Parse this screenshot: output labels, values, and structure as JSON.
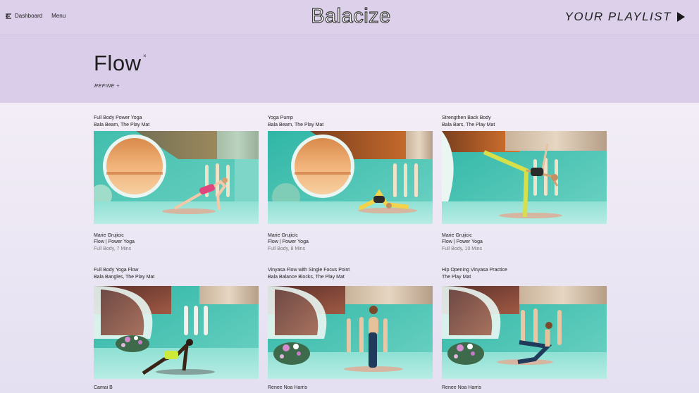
{
  "header": {
    "dashboard_label": "Dashboard",
    "menu_label": "Menu",
    "logo_text": "Balacize",
    "playlist_label": "YOUR PLAYLIST"
  },
  "page": {
    "title": "Flow",
    "clear_symbol": "×",
    "refine_label": "REFINE +"
  },
  "colors": {
    "header_bg": "#dcd0ea",
    "hero_bg": "#dacdea",
    "studio_teal": "#4fc9b5",
    "sun_orange": "#e49a55"
  },
  "classes": [
    {
      "title": "Full Body Power Yoga",
      "equipment": "Bala Beam, The Play Mat",
      "instructor": "Marie Grujicic",
      "category": "Flow | Power Yoga",
      "details": "Full Body, 7 Mins"
    },
    {
      "title": "Yoga Pump",
      "equipment": "Bala Beam, The Play Mat",
      "instructor": "Marie Grujicic",
      "category": "Flow | Power Yoga",
      "details": "Full Body, 8 Mins"
    },
    {
      "title": "Strengthen Back Body",
      "equipment": "Bala Bars, The Play Mat",
      "instructor": "Marie Grujicic",
      "category": "Flow | Power Yoga",
      "details": "Full Body, 10 Mins"
    },
    {
      "title": "Full Body Yoga Flow",
      "equipment": "Bala Bangles, The Play Mat",
      "instructor": "Camai B",
      "category": "",
      "details": ""
    },
    {
      "title": "Vinyasa Flow with Single Focus Point",
      "equipment": "Bala Balance Blocks, The Play Mat",
      "instructor": "Renee Noa Harris",
      "category": "",
      "details": ""
    },
    {
      "title": "Hip Opening Vinyasa Practice",
      "equipment": "The Play Mat",
      "instructor": "Renee Noa Harris",
      "category": "",
      "details": ""
    }
  ]
}
